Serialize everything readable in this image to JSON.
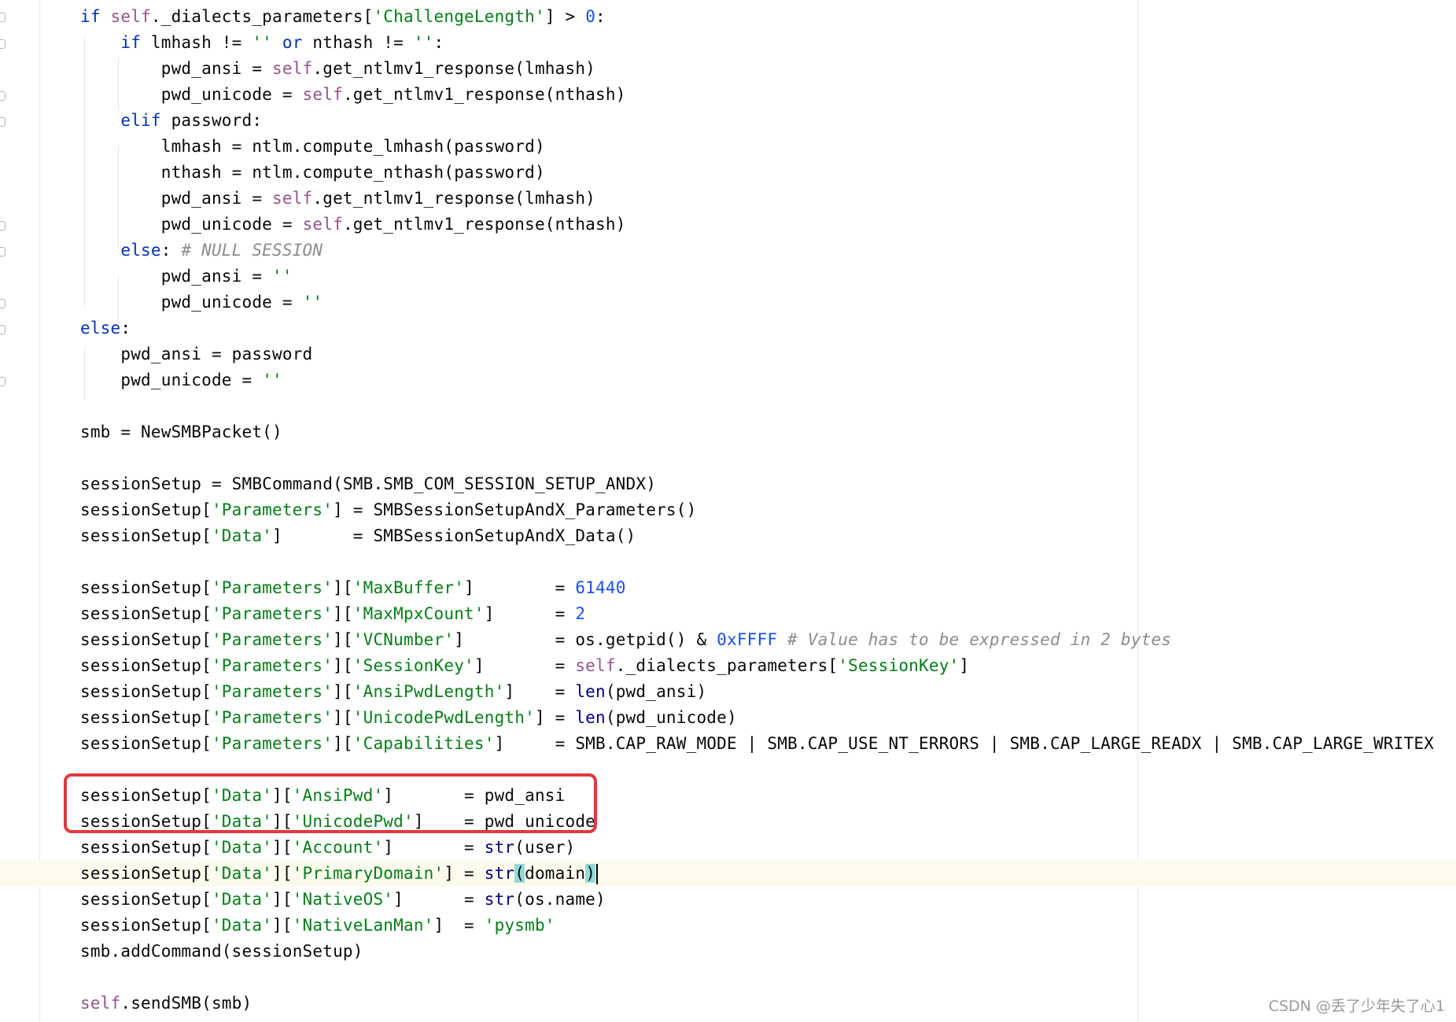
{
  "editor": {
    "lines": [
      [
        [
          "kw",
          "if "
        ],
        [
          "self",
          "self"
        ],
        [
          "",
          "._dialects_parameters["
        ],
        [
          "str",
          "'ChallengeLength'"
        ],
        [
          "",
          "] > "
        ],
        [
          "num",
          "0"
        ],
        [
          "",
          ":"
        ]
      ],
      [
        [
          "",
          "    "
        ],
        [
          "kw",
          "if "
        ],
        [
          "",
          "lmhash != "
        ],
        [
          "str",
          "''"
        ],
        [
          "kw",
          " or "
        ],
        [
          "",
          "nthash != "
        ],
        [
          "str",
          "''"
        ],
        [
          "",
          ":"
        ]
      ],
      [
        [
          "",
          "        pwd_ansi = "
        ],
        [
          "self",
          "self"
        ],
        [
          "",
          ".get_ntlmv1_response(lmhash)"
        ]
      ],
      [
        [
          "",
          "        pwd_unicode = "
        ],
        [
          "self",
          "self"
        ],
        [
          "",
          ".get_ntlmv1_response(nthash)"
        ]
      ],
      [
        [
          "",
          "    "
        ],
        [
          "kw",
          "elif "
        ],
        [
          "",
          "password:"
        ]
      ],
      [
        [
          "",
          "        lmhash = ntlm.compute_lmhash(password)"
        ]
      ],
      [
        [
          "",
          "        nthash = ntlm.compute_nthash(password)"
        ]
      ],
      [
        [
          "",
          "        pwd_ansi = "
        ],
        [
          "self",
          "self"
        ],
        [
          "",
          ".get_ntlmv1_response(lmhash)"
        ]
      ],
      [
        [
          "",
          "        pwd_unicode = "
        ],
        [
          "self",
          "self"
        ],
        [
          "",
          ".get_ntlmv1_response(nthash)"
        ]
      ],
      [
        [
          "",
          "    "
        ],
        [
          "kw",
          "else"
        ],
        [
          "",
          ": "
        ],
        [
          "cmt",
          "# NULL SESSION"
        ]
      ],
      [
        [
          "",
          "        pwd_ansi = "
        ],
        [
          "str",
          "''"
        ]
      ],
      [
        [
          "",
          "        pwd_unicode = "
        ],
        [
          "str",
          "''"
        ]
      ],
      [
        [
          "kw",
          "else"
        ],
        [
          "",
          ":"
        ]
      ],
      [
        [
          "",
          "    pwd_ansi = password"
        ]
      ],
      [
        [
          "",
          "    pwd_unicode = "
        ],
        [
          "str",
          "''"
        ]
      ],
      [
        [
          "",
          ""
        ]
      ],
      [
        [
          "",
          "smb = NewSMBPacket()"
        ]
      ],
      [
        [
          "",
          ""
        ]
      ],
      [
        [
          "",
          "sessionSetup = SMBCommand(SMB.SMB_COM_SESSION_SETUP_ANDX)"
        ]
      ],
      [
        [
          "",
          "sessionSetup["
        ],
        [
          "str",
          "'Parameters'"
        ],
        [
          "",
          "] = SMBSessionSetupAndX_Parameters()"
        ]
      ],
      [
        [
          "",
          "sessionSetup["
        ],
        [
          "str",
          "'Data'"
        ],
        [
          "",
          "]       = SMBSessionSetupAndX_Data()"
        ]
      ],
      [
        [
          "",
          ""
        ]
      ],
      [
        [
          "",
          "sessionSetup["
        ],
        [
          "str",
          "'Parameters'"
        ],
        [
          "",
          "]["
        ],
        [
          "str",
          "'MaxBuffer'"
        ],
        [
          "",
          "]        = "
        ],
        [
          "num",
          "61440"
        ]
      ],
      [
        [
          "",
          "sessionSetup["
        ],
        [
          "str",
          "'Parameters'"
        ],
        [
          "",
          "]["
        ],
        [
          "str",
          "'MaxMpxCount'"
        ],
        [
          "",
          "]      = "
        ],
        [
          "num",
          "2"
        ]
      ],
      [
        [
          "",
          "sessionSetup["
        ],
        [
          "str",
          "'Parameters'"
        ],
        [
          "",
          "]["
        ],
        [
          "str",
          "'VCNumber'"
        ],
        [
          "",
          "]         = os.getpid() & "
        ],
        [
          "num",
          "0xFFFF"
        ],
        [
          "cmt",
          " # Value has to be expressed in 2 bytes"
        ]
      ],
      [
        [
          "",
          "sessionSetup["
        ],
        [
          "str",
          "'Parameters'"
        ],
        [
          "",
          "]["
        ],
        [
          "str",
          "'SessionKey'"
        ],
        [
          "",
          "]       = "
        ],
        [
          "self",
          "self"
        ],
        [
          "",
          "._dialects_parameters["
        ],
        [
          "str",
          "'SessionKey'"
        ],
        [
          "",
          "]"
        ]
      ],
      [
        [
          "",
          "sessionSetup["
        ],
        [
          "str",
          "'Parameters'"
        ],
        [
          "",
          "]["
        ],
        [
          "str",
          "'AnsiPwdLength'"
        ],
        [
          "",
          "]    = "
        ],
        [
          "fn",
          "len"
        ],
        [
          "",
          "(pwd_ansi)"
        ]
      ],
      [
        [
          "",
          "sessionSetup["
        ],
        [
          "str",
          "'Parameters'"
        ],
        [
          "",
          "]["
        ],
        [
          "str",
          "'UnicodePwdLength'"
        ],
        [
          "",
          "] = "
        ],
        [
          "fn",
          "len"
        ],
        [
          "",
          "(pwd_unicode)"
        ]
      ],
      [
        [
          "",
          "sessionSetup["
        ],
        [
          "str",
          "'Parameters'"
        ],
        [
          "",
          "]["
        ],
        [
          "str",
          "'Capabilities'"
        ],
        [
          "",
          "]     = SMB.CAP_RAW_MODE | SMB.CAP_USE_NT_ERRORS | SMB.CAP_LARGE_READX | SMB.CAP_LARGE_WRITEX"
        ]
      ],
      [
        [
          "",
          ""
        ]
      ],
      [
        [
          "",
          "sessionSetup["
        ],
        [
          "str",
          "'Data'"
        ],
        [
          "",
          "]["
        ],
        [
          "str",
          "'AnsiPwd'"
        ],
        [
          "",
          "]       = pwd_ansi"
        ]
      ],
      [
        [
          "",
          "sessionSetup["
        ],
        [
          "str",
          "'Data'"
        ],
        [
          "",
          "]["
        ],
        [
          "str",
          "'UnicodePwd'"
        ],
        [
          "",
          "]    = pwd_unicode"
        ]
      ],
      [
        [
          "",
          "sessionSetup["
        ],
        [
          "str",
          "'Data'"
        ],
        [
          "",
          "]["
        ],
        [
          "str",
          "'Account'"
        ],
        [
          "",
          "]       = "
        ],
        [
          "fn",
          "str"
        ],
        [
          "",
          "(user)"
        ]
      ],
      [
        [
          "",
          "sessionSetup["
        ],
        [
          "str",
          "'Data'"
        ],
        [
          "",
          "]["
        ],
        [
          "str",
          "'PrimaryDomain'"
        ],
        [
          "",
          "] = "
        ],
        [
          "fn",
          "str"
        ],
        [
          "brace",
          "("
        ],
        [
          "",
          "domain"
        ],
        [
          "brace",
          ")"
        ],
        [
          "caret",
          ""
        ]
      ],
      [
        [
          "",
          "sessionSetup["
        ],
        [
          "str",
          "'Data'"
        ],
        [
          "",
          "]["
        ],
        [
          "str",
          "'NativeOS'"
        ],
        [
          "",
          "]      = "
        ],
        [
          "fn",
          "str"
        ],
        [
          "",
          "(os.name)"
        ]
      ],
      [
        [
          "",
          "sessionSetup["
        ],
        [
          "str",
          "'Data'"
        ],
        [
          "",
          "]["
        ],
        [
          "str",
          "'NativeLanMan'"
        ],
        [
          "",
          "]  = "
        ],
        [
          "str",
          "'pysmb'"
        ]
      ],
      [
        [
          "",
          "smb.addCommand(sessionSetup)"
        ]
      ],
      [
        [
          "",
          ""
        ]
      ],
      [
        [
          "self",
          "self"
        ],
        [
          "",
          ".sendSMB(smb)"
        ]
      ]
    ],
    "colors": {
      "keyword": "#0033b3",
      "self": "#94558d",
      "string": "#067d17",
      "number": "#1750eb",
      "comment": "#8c8c8c",
      "builtin": "#000080",
      "highlight_box": "#e0393e",
      "caret_row": "#fcfaed"
    }
  },
  "watermark": "CSDN @丢了少年失了心1"
}
